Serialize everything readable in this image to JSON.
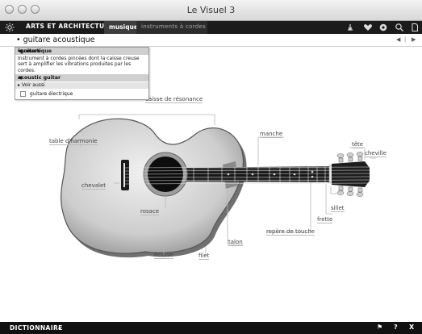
{
  "window": {
    "title": "Le Visuel 3"
  },
  "toolbar": {
    "section_label": "ARTS ET ARCHITECTURE",
    "active_tab": "musique",
    "sub_tab": "instruments à cordes",
    "icons": [
      "home-icon",
      "heart-icon",
      "target-icon",
      "search-icon",
      "document-icon"
    ]
  },
  "crumb": {
    "text": "guitare acoustique"
  },
  "popup": {
    "head1": "guitare",
    "head1_gender": "F",
    "head1_rest": " acoustique",
    "definition": "Instrument à cordes pincées dont la caisse creuse sert à amplifier les vibrations produites par les cordes.",
    "head2": "acoustic guitar",
    "see_also_label": "Voir aussi",
    "see_also_item": "guitare électrique"
  },
  "labels": {
    "caisse": "caisse de résonance",
    "table": "table d'harmonie",
    "chevalet": "chevalet",
    "rosace": "rosace",
    "eclisse": "éclisse",
    "filet": "filet",
    "talon": "talon",
    "manche": "manche",
    "tete": "tête",
    "cheville": "cheville",
    "sillet": "sillet",
    "frette": "frette",
    "repere": "repère de touche"
  },
  "bottom": {
    "dict_label": "DICTIONNAIRE",
    "help": "?",
    "close": "X"
  }
}
